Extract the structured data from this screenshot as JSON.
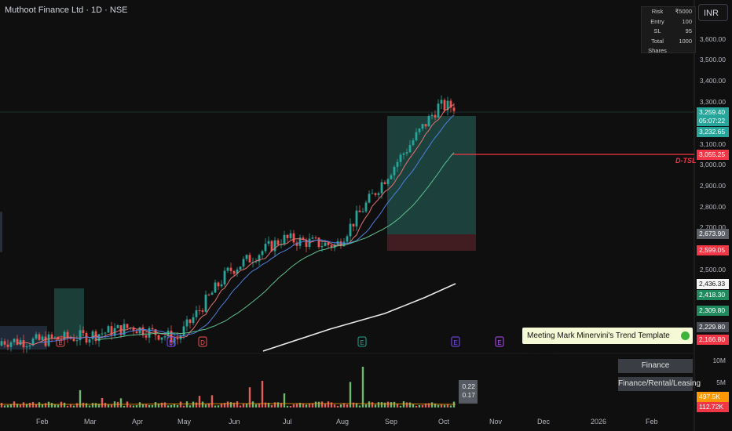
{
  "title": "Muthoot Finance Ltd · 1D · NSE",
  "currency_button": "INR",
  "risk_panel": [
    {
      "label": "Risk",
      "value": "₹5000"
    },
    {
      "label": "Entry",
      "value": "100"
    },
    {
      "label": "SL",
      "value": "95"
    },
    {
      "label": "Total Shares",
      "value": "1000"
    }
  ],
  "price_axis": [
    "3,600.00",
    "3,500.00",
    "3,400.00",
    "3,300.00",
    "3,100.00",
    "3,000.00",
    "2,900.00",
    "2,800.00",
    "2,700.00",
    "2,500.00"
  ],
  "price_tags": {
    "last": "3,259.40",
    "countdown": "05:07:22",
    "ema_fast": "3,232.65",
    "stop": "3,055.25",
    "entry": "2,673.90",
    "sl_zone": "2,599.05",
    "ma200": "2,436.33",
    "green_a": "2,418.30",
    "green_b": "2,309.80",
    "grey_a": "2,229.80",
    "red_a": "2,166.80"
  },
  "dtsl_label": "D-TSL",
  "minervini_text": "Meeting Mark Minervini's Trend Template Criteria?",
  "sector": "Finance",
  "industry": "Finance/Rental/Leasing",
  "volume_axis": [
    "10M",
    "5M"
  ],
  "volume_tags": {
    "vol_ma": "497.5K",
    "vol_last": "112.72K"
  },
  "volume_label": {
    "top": "0.22",
    "bottom": "0.17"
  },
  "months": [
    "Feb",
    "Mar",
    "Apr",
    "May",
    "Jun",
    "Jul",
    "Aug",
    "Sep",
    "Oct",
    "Nov",
    "Dec",
    "2026",
    "Feb"
  ],
  "event_markers": [
    "E",
    "D",
    "D",
    "E",
    "E",
    "E"
  ],
  "colors": {
    "up": "#26a69a",
    "down": "#ef5350",
    "bg": "#0f0f0f",
    "target_zone": "#1f4a44",
    "stop_zone": "#4a1f24"
  },
  "chart_data": {
    "type": "candlestick",
    "symbol": "Muthoot Finance Ltd",
    "interval": "1D",
    "exchange": "NSE",
    "y_range": [
      2200,
      3650
    ],
    "approx_closes_by_month": {
      "Feb": 2250,
      "Mar": 2270,
      "Apr": 2310,
      "May": 2260,
      "Jun": 2550,
      "Jul": 2690,
      "Aug": 2660,
      "Sep": 2950,
      "Oct": 3259.4
    },
    "last_price": 3259.4,
    "stop_level": 3055.25,
    "entry_level": 2673.9
  }
}
